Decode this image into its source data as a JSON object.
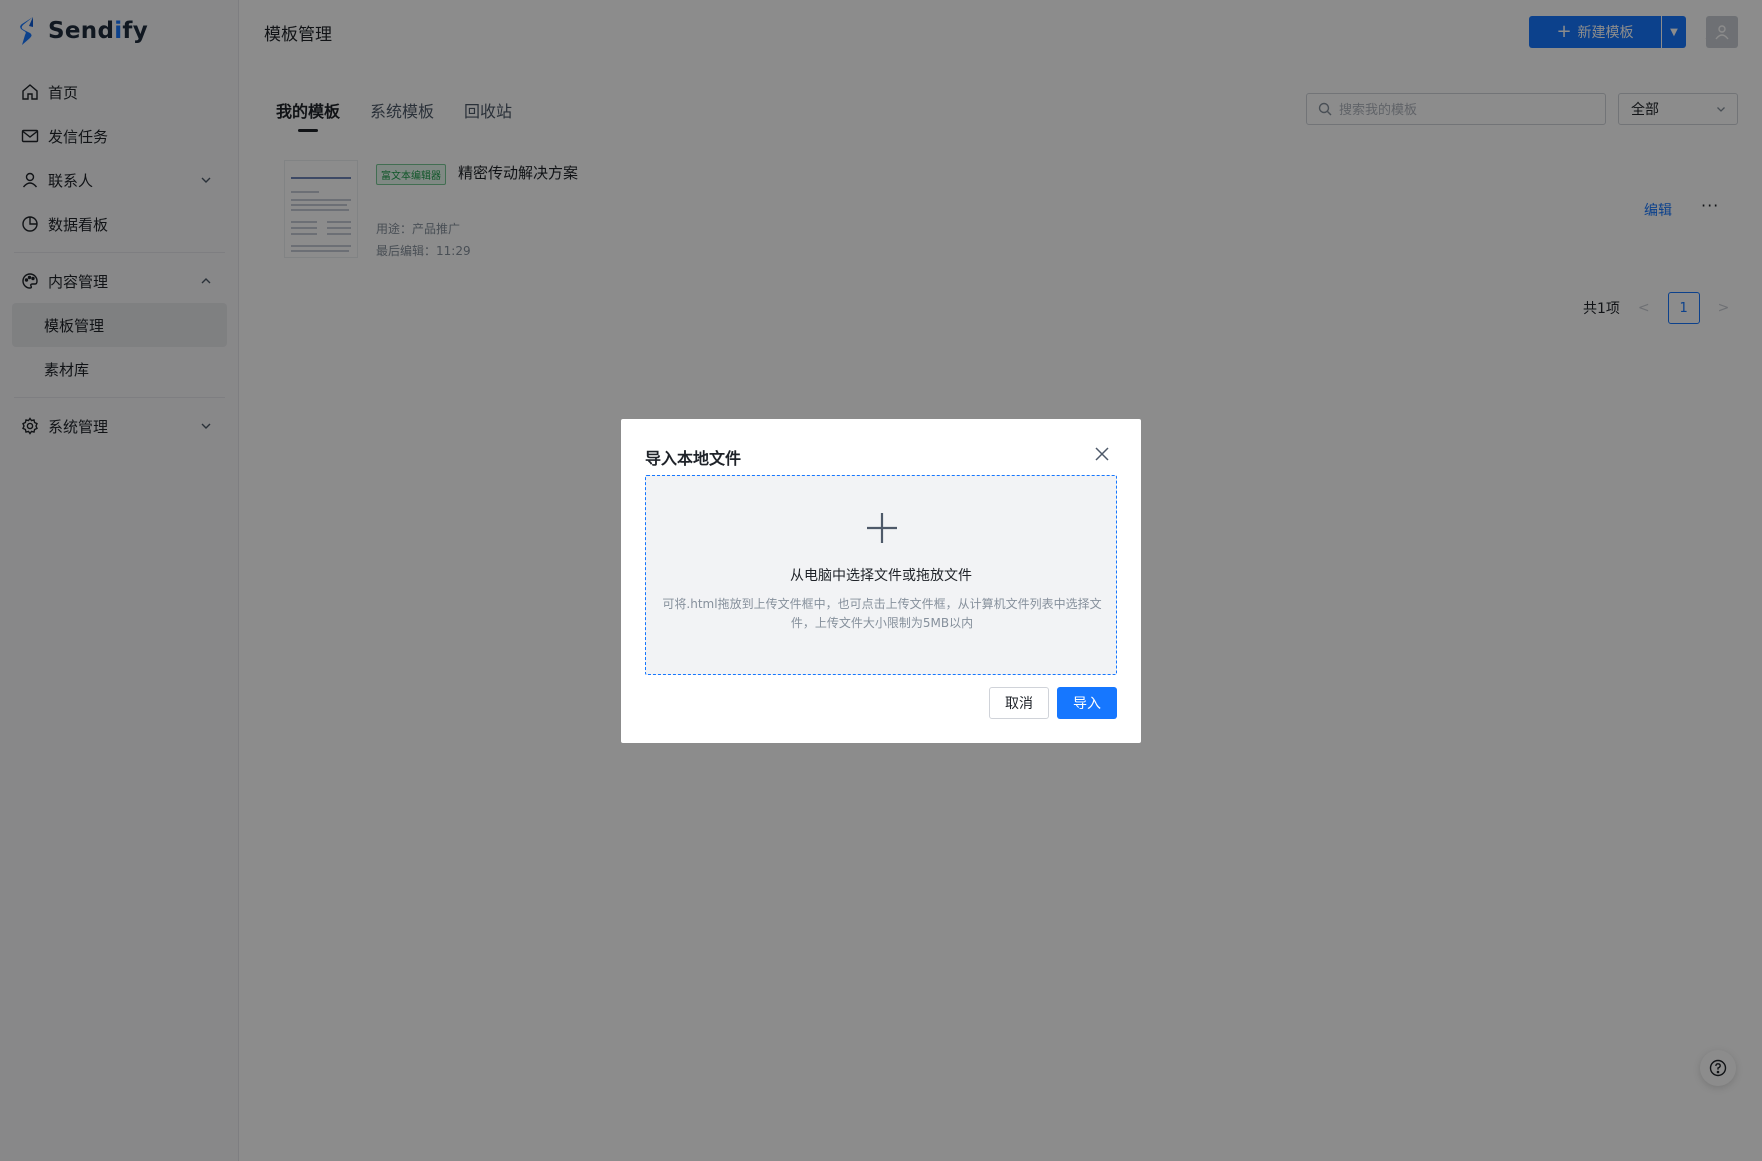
{
  "app": {
    "logo_text_a": "Send",
    "logo_text_accent": "i",
    "logo_text_b": "fy",
    "accent_color": "#1677ff"
  },
  "sidebar": {
    "items": [
      {
        "label": "首页",
        "icon": "home-icon"
      },
      {
        "label": "发信任务",
        "icon": "mail-icon"
      },
      {
        "label": "联系人",
        "icon": "user-icon"
      },
      {
        "label": "数据看板",
        "icon": "pie-chart-icon"
      },
      {
        "label": "内容管理",
        "icon": "palette-icon"
      },
      {
        "label": "模板管理"
      },
      {
        "label": "素材库"
      },
      {
        "label": "系统管理",
        "icon": "gear-icon"
      }
    ]
  },
  "header": {
    "title": "模板管理",
    "new_button": "新建模板"
  },
  "tabs": [
    {
      "label": "我的模板"
    },
    {
      "label": "系统模板"
    },
    {
      "label": "回收站"
    }
  ],
  "search": {
    "placeholder": "搜索我的模板"
  },
  "filter": {
    "value": "全部"
  },
  "template": {
    "badge": "富文本编辑器",
    "title": "精密传动解决方案",
    "purpose": "用途：产品推广",
    "last_edit": "最后编辑：11:29",
    "edit_label": "编辑",
    "more_label": "···"
  },
  "pager": {
    "total": "共1项",
    "current": "1"
  },
  "modal": {
    "title": "导入本地文件",
    "drop_title": "从电脑中选择文件或拖放文件",
    "drop_hint": "可将.html拖放到上传文件框中，也可点击上传文件框，从计算机文件列表中选择文件，上传文件大小限制为5MB以内",
    "cancel": "取消",
    "import": "导入"
  }
}
